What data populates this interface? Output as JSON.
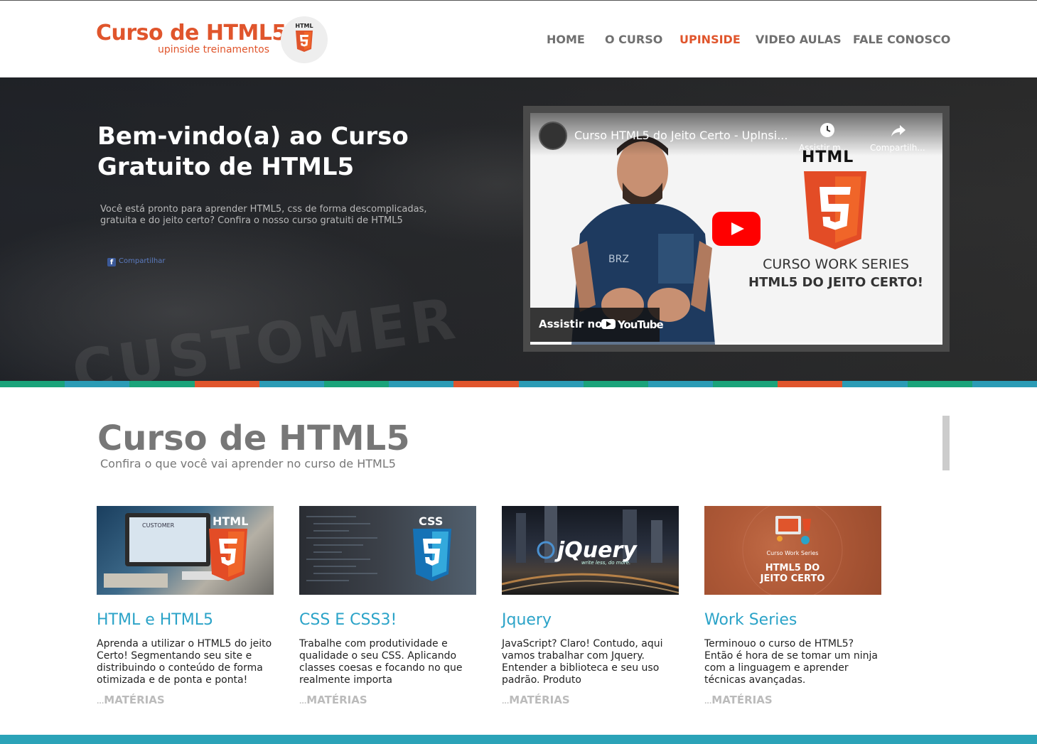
{
  "header": {
    "logo_title": "Curso de HTML5",
    "logo_subtitle": "upinside treinamentos",
    "badge_text": "HTML",
    "nav": [
      {
        "label": "HOME",
        "active": false
      },
      {
        "label": "O CURSO",
        "active": false
      },
      {
        "label": "UPINSIDE",
        "active": true
      },
      {
        "label": "VIDEO AULAS",
        "active": false
      },
      {
        "label": "FALE CONOSCO",
        "active": false
      }
    ]
  },
  "hero": {
    "title": "Bem-vindo(a) ao Curso Gratuito de HTML5",
    "text": "Você está pronto para aprender HTML5, css de forma descomplicadas, gratuita e do jeito certo? Confira o nosso curso gratuiti de HTML5",
    "share_label": "Compartilhar",
    "background_word": "CUSTOMER"
  },
  "video": {
    "title": "Curso HTML5 do Jeito Certo - UpInsi...",
    "watch_later": "Assistir m...",
    "share": "Compartilh...",
    "thumb_html_label": "HTML",
    "thumb_line1": "CURSO WORK SERIES",
    "thumb_line2": "HTML5 DO JEITO CERTO!",
    "watch_on": "Assistir no",
    "youtube": "YouTube"
  },
  "section": {
    "title": "Curso de HTML5",
    "subtitle": "Confira o que você vai aprender no curso de HTML5"
  },
  "cards": [
    {
      "title": "HTML e HTML5",
      "text": "Aprenda a utilizar o HTML5 do jeito Certo! Segmentando seu site e distribuindo o conteúdo de forma otimizada e de ponta e ponta!",
      "more_dots": "...",
      "more": "MATÉRIAS",
      "img_label": "HTML",
      "img_word": "CUSTOMER"
    },
    {
      "title": "CSS E CSS3!",
      "text": "Trabalhe com produtividade e qualidade o seu CSS. Aplicando classes coesas e focando no que realmente importa",
      "more_dots": "...",
      "more": "MATÉRIAS",
      "img_label": "CSS"
    },
    {
      "title": "Jquery",
      "text": "JavaScript? Claro! Contudo, aqui vamos trabalhar com Jquery. Entender a biblioteca e seu uso padrão. Produto",
      "more_dots": "...",
      "more": "MATÉRIAS",
      "img_label": "jQuery",
      "img_tagline": "write less, do more."
    },
    {
      "title": "Work Series",
      "text": "Terminouo o curso de HTML5? Então é hora de se tomar um ninja com a linguagem e aprender técnicas avançadas.",
      "more_dots": "...",
      "more": "MATÉRIAS",
      "img_small": "Curso Work Series",
      "img_line1": "HTML5 DO",
      "img_line2": "JEITO CERTO"
    }
  ],
  "colors": {
    "brand_orange": "#e0552c",
    "accent_blue": "#2ba3c8",
    "stripe": [
      "#1aa37a",
      "#2b9bb5",
      "#1aa37a",
      "#e0552c",
      "#2b9bb5",
      "#1aa37a",
      "#2b9bb5",
      "#e0552c",
      "#2b9bb5",
      "#1aa37a",
      "#2b9bb5",
      "#1aa37a",
      "#e0552c",
      "#2b9bb5",
      "#1aa37a",
      "#2b9bb5"
    ]
  }
}
